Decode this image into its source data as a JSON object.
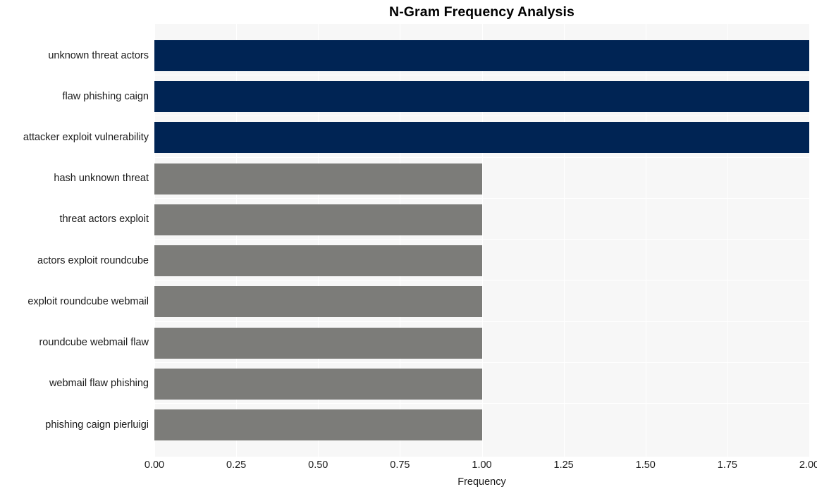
{
  "chart_data": {
    "type": "bar",
    "orientation": "horizontal",
    "title": "N-Gram Frequency Analysis",
    "xlabel": "Frequency",
    "ylabel": "",
    "xlim": [
      0.0,
      2.0
    ],
    "xticks": [
      "0.00",
      "0.25",
      "0.50",
      "0.75",
      "1.00",
      "1.25",
      "1.50",
      "1.75",
      "2.00"
    ],
    "xtick_values": [
      0.0,
      0.25,
      0.5,
      0.75,
      1.0,
      1.25,
      1.5,
      1.75,
      2.0
    ],
    "grid": true,
    "legend": false,
    "categories": [
      "unknown threat actors",
      "flaw phishing caign",
      "attacker exploit vulnerability",
      "hash unknown threat",
      "threat actors exploit",
      "actors exploit roundcube",
      "exploit roundcube webmail",
      "roundcube webmail flaw",
      "webmail flaw phishing",
      "phishing caign pierluigi"
    ],
    "values": [
      2,
      2,
      2,
      1,
      1,
      1,
      1,
      1,
      1,
      1
    ],
    "bar_colors": [
      "#002454",
      "#002454",
      "#002454",
      "#7c7c79",
      "#7c7c79",
      "#7c7c79",
      "#7c7c79",
      "#7c7c79",
      "#7c7c79",
      "#7c7c79"
    ]
  },
  "style": {
    "plot_background": "#f7f7f7",
    "page_background": "#ffffff",
    "gridline_color": "#ffffff",
    "highlight_color": "#002454",
    "default_color": "#7c7c79",
    "text_color": "#1b1b1b"
  }
}
